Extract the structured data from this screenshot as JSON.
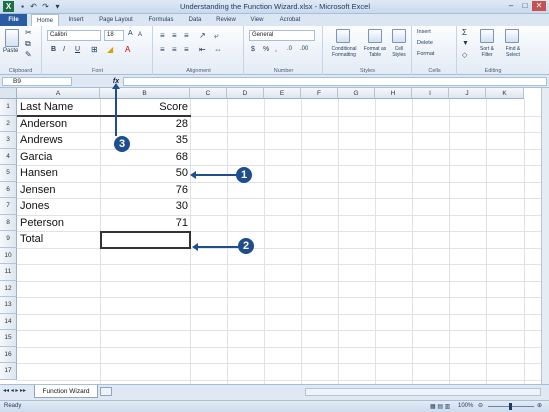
{
  "window": {
    "title": "Understanding the Function Wizard.xlsx - Microsoft Excel"
  },
  "quick_access": [
    "X",
    "↶",
    "↷",
    "▾"
  ],
  "tabs": [
    "File",
    "Home",
    "Insert",
    "Page Layout",
    "Formulas",
    "Data",
    "Review",
    "View",
    "Acrobat"
  ],
  "ribbon": {
    "clipboard": {
      "label": "Clipboard",
      "paste": "Paste"
    },
    "font": {
      "label": "Font",
      "name": "Calibri",
      "size": "18",
      "bold": "B",
      "italic": "I",
      "underline": "U"
    },
    "alignment": {
      "label": "Alignment"
    },
    "number": {
      "label": "Number",
      "format": "General",
      "currency": "$",
      "percent": "%"
    },
    "styles": {
      "label": "Styles",
      "conditional": "Conditional Formatting",
      "format_table": "Format as Table",
      "cell_styles": "Cell Styles"
    },
    "cells": {
      "label": "Cells",
      "insert": "Insert",
      "delete": "Delete",
      "format": "Format"
    },
    "editing": {
      "label": "Editing",
      "sort": "Sort & Filter",
      "find": "Find & Select",
      "sum": "Σ"
    }
  },
  "formula_bar": {
    "name_box": "B9",
    "fx": "fx",
    "value": ""
  },
  "columns": [
    "A",
    "B",
    "C",
    "D",
    "E",
    "F",
    "G",
    "H",
    "I",
    "J",
    "K"
  ],
  "rows": [
    "1",
    "2",
    "3",
    "4",
    "5",
    "6",
    "7",
    "8",
    "9",
    "10",
    "11",
    "12",
    "13",
    "14",
    "15",
    "16",
    "17"
  ],
  "cells": {
    "A1": "Last Name",
    "B1": "Score",
    "A2": "Anderson",
    "B2": "28",
    "A3": "Andrews",
    "B3": "35",
    "A4": "Garcia",
    "B4": "68",
    "A5": "Hansen",
    "B5": "50",
    "A6": "Jensen",
    "B6": "76",
    "A7": "Jones",
    "B7": "30",
    "A8": "Peterson",
    "B8": "71",
    "A9": "Total"
  },
  "sheet_tab": "Function Wizard",
  "status": {
    "mode": "Ready",
    "zoom": "100%"
  },
  "callouts": [
    "1",
    "2",
    "3"
  ]
}
